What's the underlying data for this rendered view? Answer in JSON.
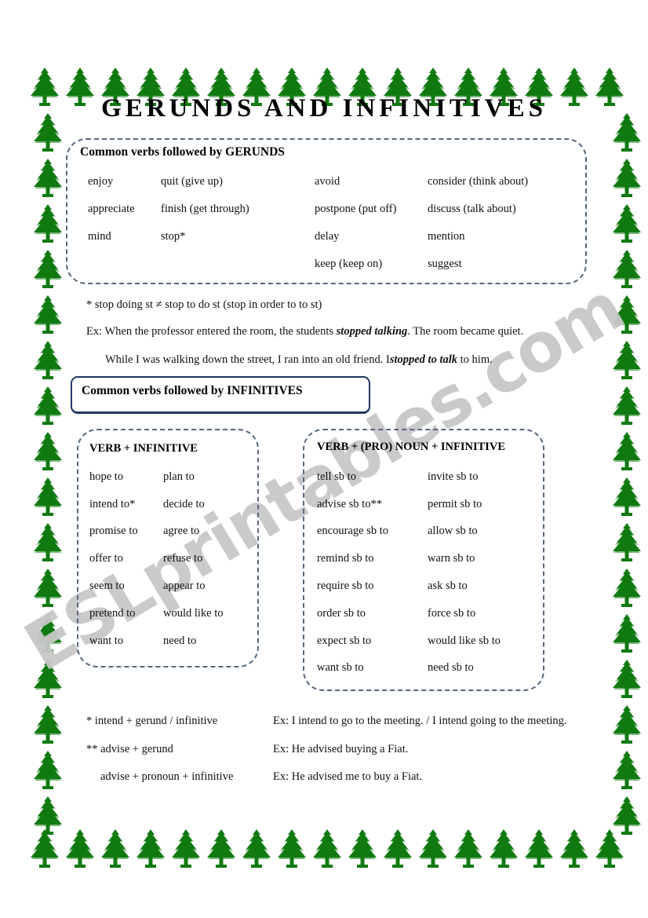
{
  "page": {
    "title": "GERUNDS AND INFINITIVES",
    "watermark": "ESLprintables.com",
    "border_icon": "pine-tree-icon",
    "colors": {
      "tree_green": "#117a11",
      "dashed_border": "#56677f",
      "solid_border": "#1f3864",
      "watermark_gray": "#c8c8c8",
      "text": "#000000"
    }
  },
  "gerunds_section": {
    "heading": "Common verbs followed by GERUNDS",
    "columns": [
      [
        "enjoy",
        "appreciate",
        "mind"
      ],
      [
        "quit (give up)",
        "finish (get through)",
        "stop*"
      ],
      [
        "avoid",
        "postpone (put off)",
        "delay",
        "keep (keep on)"
      ],
      [
        "consider (think about)",
        "discuss (talk about)",
        "mention",
        "suggest"
      ]
    ]
  },
  "gerund_notes": {
    "rule": "* stop doing st ≠ stop to do st (stop in order to to st)",
    "example1_pre": "Ex: When the professor entered the room, the students ",
    "example1_em": "stopped talking",
    "example1_post": ". The room became quiet.",
    "example2_pre": "While I was walking down the street, I ran into an old friend. I",
    "example2_em": "stopped to talk",
    "example2_post": " to him."
  },
  "infinitives_section": {
    "heading": "Common verbs followed by INFINITIVES",
    "verb_infinitive": {
      "heading": "VERB + INFINITIVE",
      "columns": [
        [
          "hope to",
          "intend to*",
          "promise to",
          "offer to",
          "seem to",
          "pretend to",
          "want to"
        ],
        [
          "plan to",
          "decide to",
          "agree to",
          "refuse to",
          "appear to",
          "would like to",
          "need to"
        ]
      ]
    },
    "verb_pronoun_infinitive": {
      "heading": "VERB + (PRO) NOUN + INFINITIVE",
      "columns": [
        [
          "tell sb to",
          "advise sb to**",
          "encourage sb to",
          "remind sb to",
          "require sb to",
          "order sb to",
          "expect sb to",
          "want sb to"
        ],
        [
          "invite sb to",
          "permit sb to",
          "allow sb to",
          "warn sb to",
          "ask sb to",
          "force sb to",
          "would like sb to",
          "need sb to"
        ]
      ]
    }
  },
  "footnotes": [
    {
      "label": "* intend + gerund / infinitive",
      "example": "Ex: I intend to go to the meeting. / I intend going to the meeting."
    },
    {
      "label": "** advise + gerund",
      "example": "Ex: He advised buying a Fiat."
    },
    {
      "label": "advise + pronoun + infinitive",
      "example": "Ex: He advised me to buy a Fiat."
    }
  ]
}
